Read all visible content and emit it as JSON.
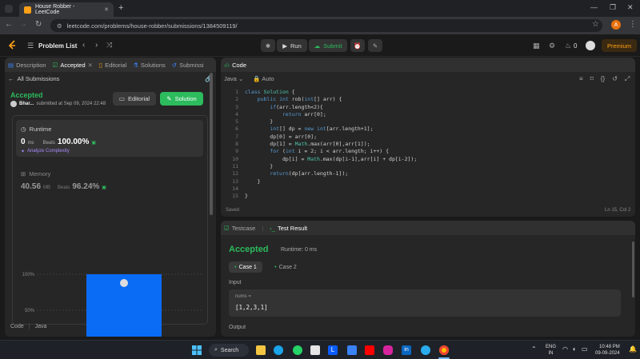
{
  "browser": {
    "tab_title": "House Robber - LeetCode",
    "url": "leetcode.com/problems/house-robber/submissions/1384509119/",
    "profile_initial": "A"
  },
  "nav": {
    "problem_list": "Problem List",
    "run": "Run",
    "submit": "Submit",
    "streak_count": "0",
    "premium": "Premium"
  },
  "left_tabs": {
    "description": "Description",
    "accepted": "Accepted",
    "editorial": "Editorial",
    "solutions": "Solutions",
    "submissions": "Submissi"
  },
  "submission": {
    "all_submissions": "All Submissions",
    "status": "Accepted",
    "user": "Bhar...",
    "submitted_at": "submitted at Sep 09, 2024 22:48",
    "editorial_btn": "Editorial",
    "solution_btn": "Solution",
    "runtime_label": "Runtime",
    "runtime_value": "0",
    "runtime_unit": "ms",
    "beats_label": "Beats",
    "runtime_beats": "100.00%",
    "analyze": "Analyze Complexity",
    "memory_label": "Memory",
    "memory_value": "40.56",
    "memory_unit": "MB",
    "memory_beats": "96.24%",
    "footer_code": "Code",
    "footer_lang": "Java"
  },
  "chart_data": {
    "type": "bar",
    "categories": [
      ""
    ],
    "values": [
      100
    ],
    "ylim": [
      0,
      100
    ],
    "yticks": [
      "100%",
      "50%",
      "0%"
    ],
    "grid": true
  },
  "editor": {
    "title": "Code",
    "language": "Java",
    "auto": "Auto",
    "status": "Saved",
    "cursor": "Ln 15, Col 2",
    "lines": [
      "class Solution {",
      "    public int rob(int[] arr) {",
      "        if(arr.length<2){",
      "            return arr[0];",
      "        }",
      "        int[] dp = new int[arr.length+1];",
      "        dp[0] = arr[0];",
      "        dp[1] = Math.max(arr[0],arr[1]);",
      "        for (int i = 2; i < arr.length; i++) {",
      "            dp[i] = Math.max(dp[i-1],arr[i] + dp[i-2]);",
      "        }",
      "        return(dp[arr.length-1]);",
      "    }",
      "",
      "}"
    ],
    "line_numbers": [
      "1",
      "2",
      "3",
      "4",
      "5",
      "6",
      "7",
      "8",
      "9",
      "10",
      "11",
      "12",
      "13",
      "14",
      "15"
    ]
  },
  "result": {
    "testcase_tab": "Testcase",
    "result_tab": "Test Result",
    "status": "Accepted",
    "runtime": "Runtime: 0 ms",
    "case1": "Case 1",
    "case2": "Case 2",
    "input_label": "Input",
    "param_name": "nums =",
    "param_value": "[1,2,3,1]",
    "output_label": "Output"
  },
  "taskbar": {
    "search": "Search",
    "lang1": "ENG",
    "lang2": "IN",
    "time": "10:48 PM",
    "date": "09-09-2024"
  },
  "colors": {
    "accent_green": "#2cbb5d",
    "accent_orange": "#ffa116",
    "bar_blue": "#0a6bf5"
  }
}
